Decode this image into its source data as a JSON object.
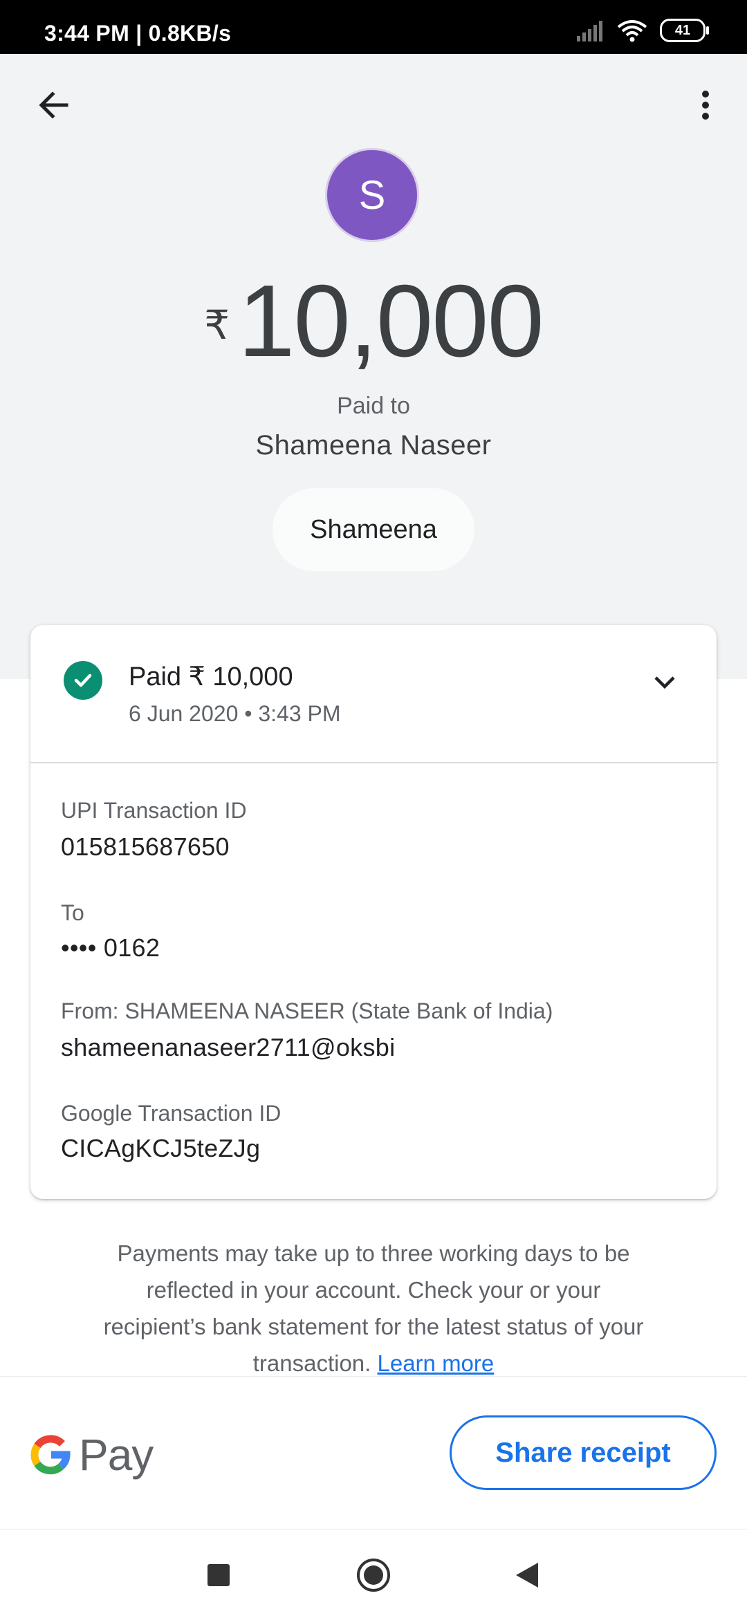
{
  "status_bar": {
    "time_speed": "3:44 PM | 0.8KB/s",
    "battery": "41",
    "icons": [
      "signal-icon",
      "wifi-icon",
      "battery-icon"
    ]
  },
  "header": {
    "back_icon": "arrow-back-icon",
    "menu_icon": "more-vert-icon",
    "avatar_letter": "S",
    "avatar_color": "#7e57c2",
    "currency": "₹",
    "amount": "10,000",
    "paid_to_label": "Paid to",
    "payee_name": "Shameena Naseer",
    "chip_label": "Shameena"
  },
  "transaction": {
    "status_text": "Paid ₹ 10,000",
    "status_color": "#0b8f72",
    "datetime": "6 Jun 2020 • 3:43 PM",
    "details": [
      {
        "label": "UPI Transaction ID",
        "value": "015815687650"
      },
      {
        "label": "To",
        "value": "•••• 0162"
      },
      {
        "label": "From: SHAMEENA  NASEER (State Bank of India)",
        "value": "shameenanaseer2711@oksbi"
      },
      {
        "label": "Google Transaction ID",
        "value": "CICAgKCJ5teZJg"
      }
    ]
  },
  "note": {
    "text": "Payments may take up to three working days to be reflected in your account. Check your or your recipient’s bank statement for the latest status of your transaction.",
    "link": "Learn more"
  },
  "footer": {
    "brand_text": "Pay",
    "share_button": "Share receipt",
    "accent": "#1a73e8"
  }
}
